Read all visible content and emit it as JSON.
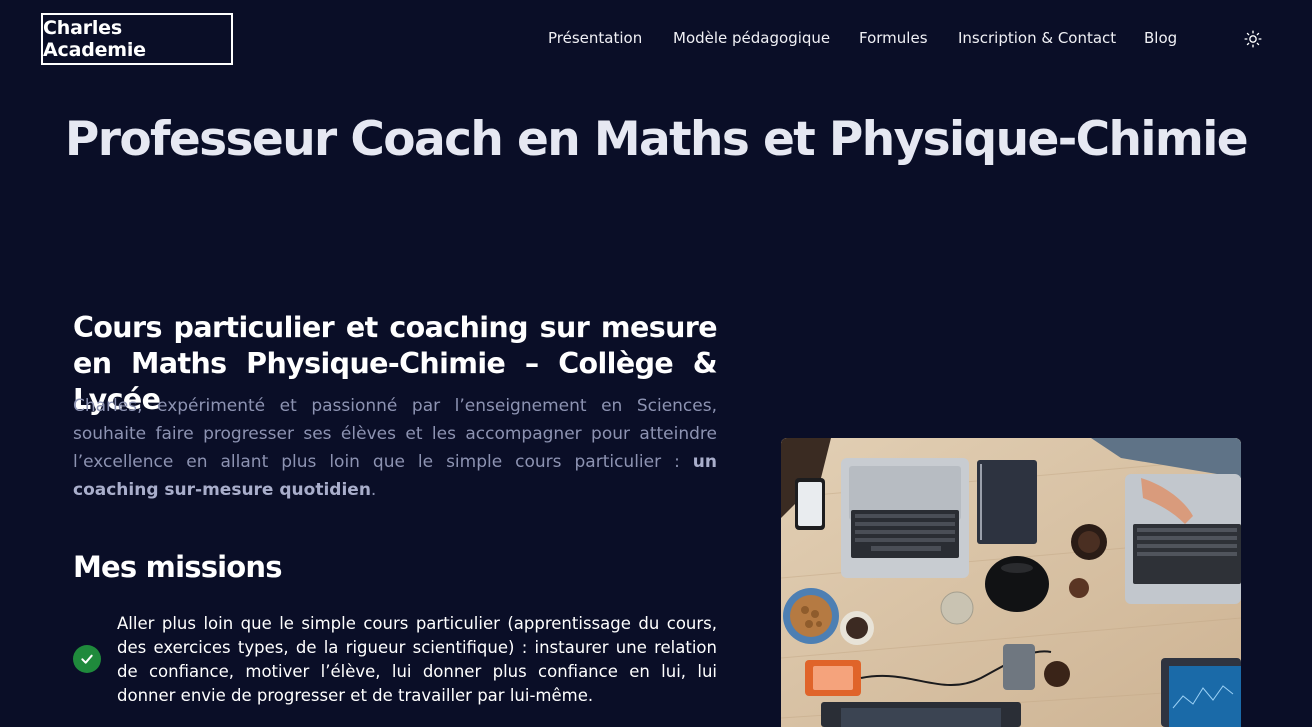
{
  "header": {
    "logo": "Charles Academie",
    "nav": [
      {
        "label": "Présentation"
      },
      {
        "label": "Modèle pédagogique"
      },
      {
        "label": "Formules"
      },
      {
        "label": "Inscription & Contact"
      },
      {
        "label": "Blog"
      }
    ],
    "theme_icon": "sun-icon"
  },
  "hero": {
    "title": "Professeur Coach en Maths et Physique-Chimie"
  },
  "main": {
    "section_title": "Cours particulier et coaching sur mesure en Maths Physique-Chimie – Collège & Lycée",
    "intro_text": "Charles, expérimenté et passionné par l’enseignement en Sciences, souhaite faire progresser ses élèves et les accompagner pour atteindre l’excellence en allant plus loin que le simple cours particulier : ",
    "intro_bold": "un coaching sur-mesure quotidien",
    "intro_end": ".",
    "missions_title": "Mes missions",
    "missions": [
      {
        "text": "Aller plus loin que le simple cours particulier (apprentissage du cours, des exercices types, de la rigueur scientifique) : instaurer une relation de confiance, motiver l’élève, lui donner plus confiance en lui, lui donner envie de progresser et de travailler par lui-même."
      }
    ]
  },
  "colors": {
    "background": "#0a0e27",
    "text_primary": "#ffffff",
    "text_muted": "#8d93b2",
    "check_green": "#1f8a3c"
  }
}
